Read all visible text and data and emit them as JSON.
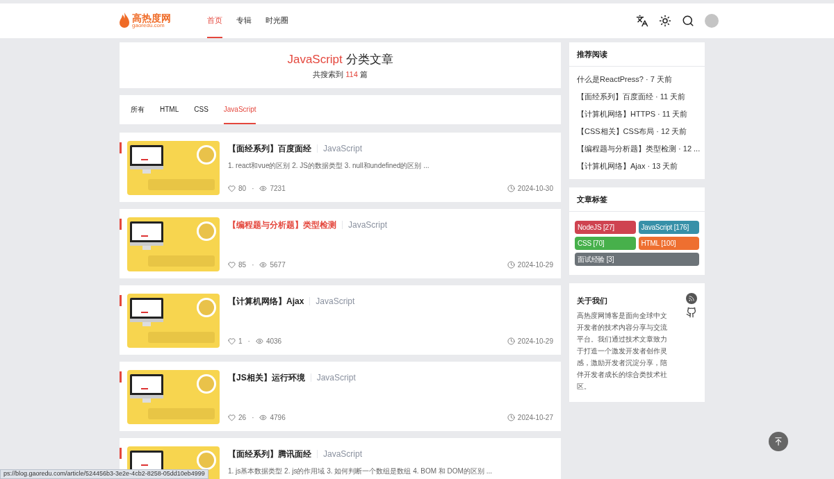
{
  "header": {
    "logo": {
      "name": "高热度网",
      "domain": "gaoredu.com"
    },
    "nav": [
      {
        "label": "首页",
        "selected": true
      },
      {
        "label": "专辑",
        "selected": false
      },
      {
        "label": "时光圈",
        "selected": false
      }
    ]
  },
  "category": {
    "title_highlight": "JavaScript",
    "title_rest": "分类文章",
    "count_prefix": "共搜索到",
    "count": "114",
    "count_suffix": "篇"
  },
  "tabs": [
    {
      "label": "所有",
      "selected": false
    },
    {
      "label": "HTML",
      "selected": false
    },
    {
      "label": "CSS",
      "selected": false
    },
    {
      "label": "JavaScript",
      "selected": true
    }
  ],
  "articles": [
    {
      "title": "【面经系列】百度面经",
      "highlighted": false,
      "tag": "JavaScript",
      "summary": "1. react和vue的区别 2. JS的数据类型 3. null和undefined的区别 ...",
      "likes": "80",
      "separator": "·",
      "views": "7231",
      "date": "2024-10-30"
    },
    {
      "title": "【编程题与分析题】类型检测",
      "highlighted": true,
      "tag": "JavaScript",
      "likes": "85",
      "separator": "·",
      "views": "5677",
      "date": "2024-10-29"
    },
    {
      "title": "【计算机网络】Ajax",
      "highlighted": false,
      "tag": "JavaScript",
      "likes": "1",
      "separator": "·",
      "views": "4036",
      "date": "2024-10-29"
    },
    {
      "title": "【JS相关】运行环境",
      "highlighted": false,
      "tag": "JavaScript",
      "likes": "26",
      "separator": "·",
      "views": "4796",
      "date": "2024-10-27"
    },
    {
      "title": "【面经系列】腾讯面经",
      "highlighted": false,
      "tag": "JavaScript",
      "summary": "1. js基本数据类型 2. js的作用域 3. 如何判断一个数组是数组 4. BOM 和 DOM的区别 ..."
    }
  ],
  "recommended": {
    "title": "推荐阅读",
    "items": [
      "什么是ReactPress?  · 7 天前",
      "【面经系列】百度面经 · 11 天前",
      "【计算机网络】HTTPS · 11 天前",
      "【CSS相关】CSS布局 · 12 天前",
      "【编程题与分析题】类型检测 · 12 ...",
      "【计算机网络】Ajax · 13 天前"
    ]
  },
  "tags": {
    "title": "文章标签",
    "items": [
      {
        "label": "NodeJS [27]",
        "color": "#cf4350"
      },
      {
        "label": "JavaScript [176]",
        "color": "#3790a8"
      },
      {
        "label": "CSS [70]",
        "color": "#47b04b"
      },
      {
        "label": "HTML [100]",
        "color": "#ee6f30"
      },
      {
        "label": "面试经验 [3]",
        "color": "#6c7378"
      }
    ]
  },
  "about": {
    "title": "关于我们",
    "text": "高热度网博客是面向全球中文开发者的技术内容分享与交流平台。我们通过技术文章致力于打造一个激发开发者创作灵感，激励开发者沉淀分享，陪伴开发者成长的综合类技术社区。"
  },
  "status_bar": "ps://blog.gaoredu.com/article/524456b3-3e2e-4cb2-8258-05dd10eb4999"
}
